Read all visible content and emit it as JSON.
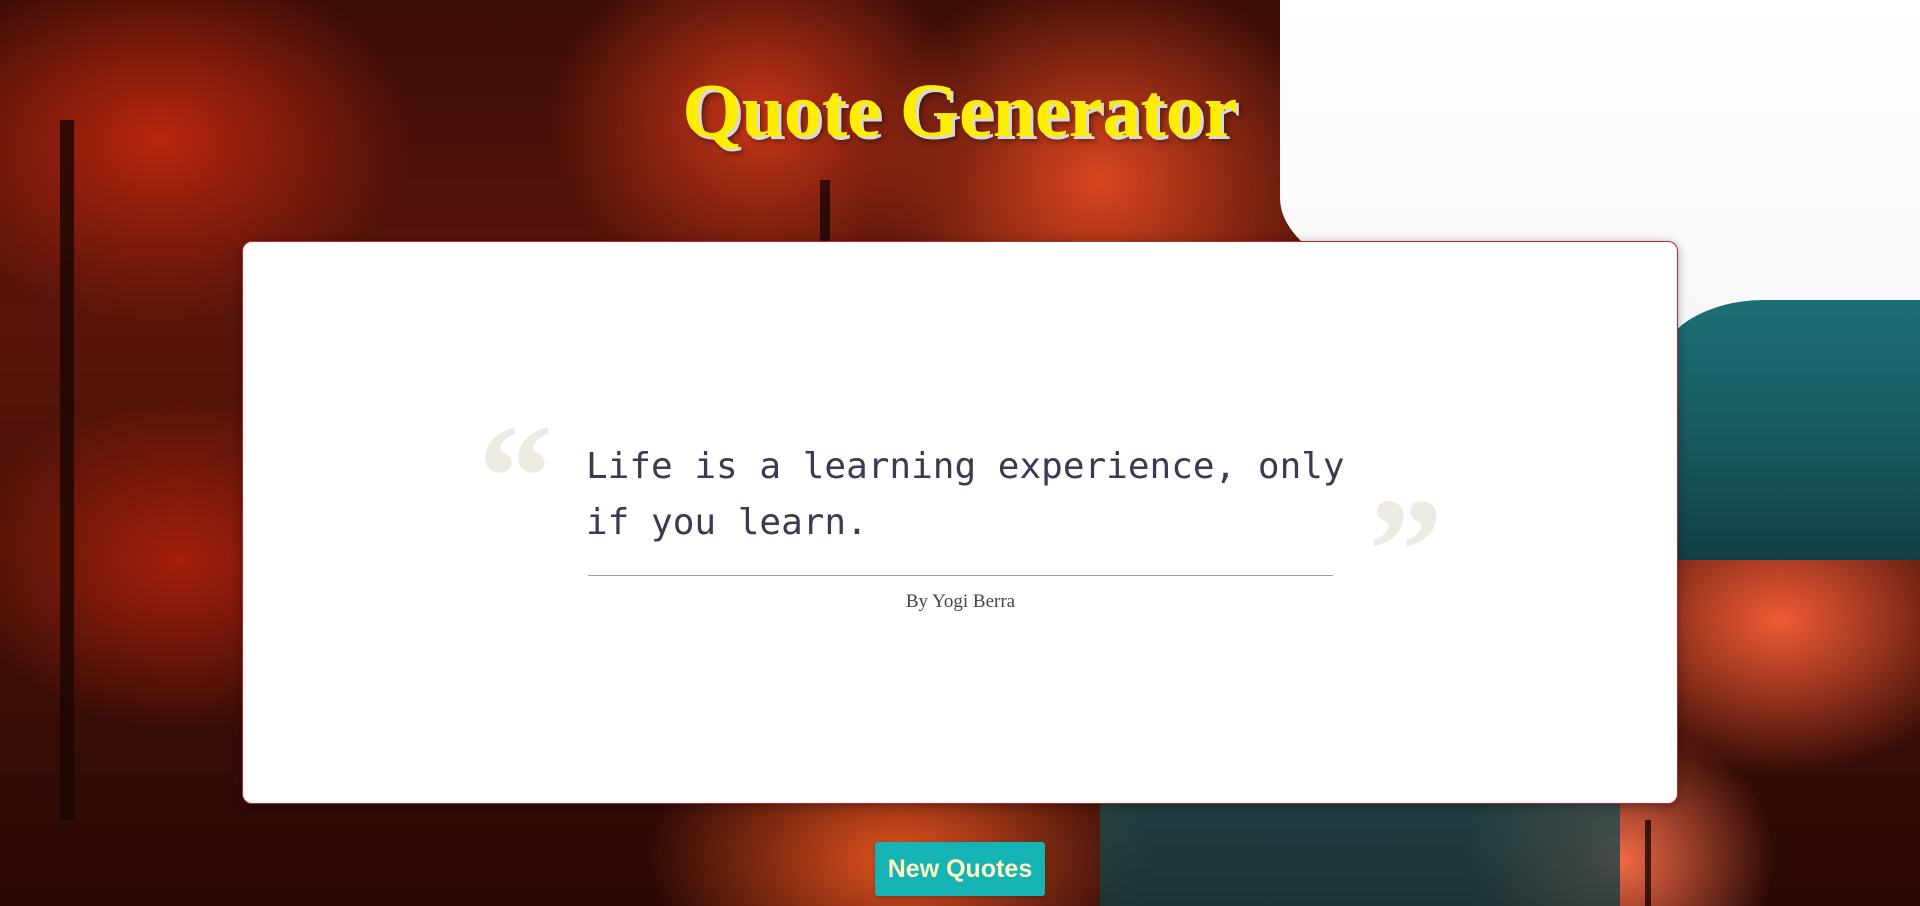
{
  "header": {
    "title": "Quote Generator",
    "title_color": "#ffee00"
  },
  "quote": {
    "open_mark": "“",
    "close_mark": "”",
    "text": "Life is a learning experience, only if you learn.",
    "author": "By Yogi Berra",
    "text_color": "#3a3a52",
    "border_color": "#c0262a"
  },
  "actions": {
    "new_quote_label": "New Quotes",
    "button_color": "#16b3b5"
  },
  "background": {
    "description_colors": [
      "#b8260f",
      "#d9451f",
      "#1c6f76",
      "#ffffff"
    ]
  }
}
